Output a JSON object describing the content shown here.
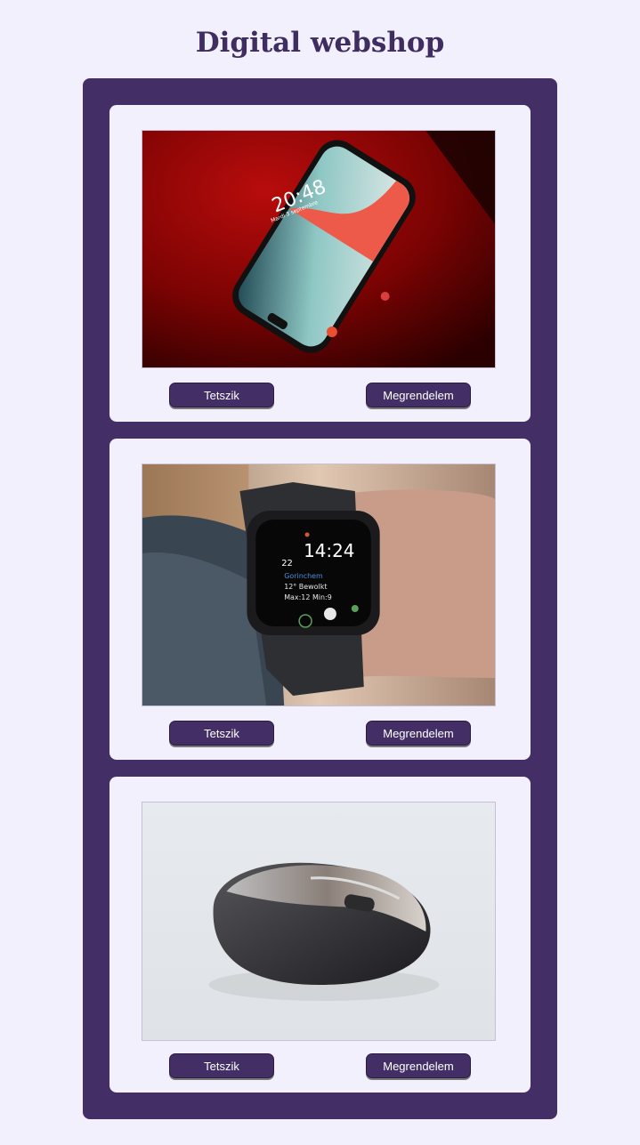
{
  "page": {
    "title": "Digital webshop"
  },
  "products": [
    {
      "image": "smartphone-photo",
      "phone_time": "20:48",
      "phone_date": "Mardi 3 septembre",
      "like_label": "Tetszik",
      "order_label": "Megrendelem"
    },
    {
      "image": "smartwatch-photo",
      "watch_date": "22",
      "watch_time": "14:24",
      "watch_city": "Gorinchem",
      "watch_weather": "12° Bewolkt",
      "watch_minmax": "Max:12 Min:9",
      "like_label": "Tetszik",
      "order_label": "Megrendelem"
    },
    {
      "image": "computer-mouse-photo",
      "like_label": "Tetszik",
      "order_label": "Megrendelem"
    }
  ],
  "colors": {
    "background": "#f1f0fc",
    "accent": "#432f66",
    "title": "#3f2d62",
    "button_text": "#ffffff"
  }
}
